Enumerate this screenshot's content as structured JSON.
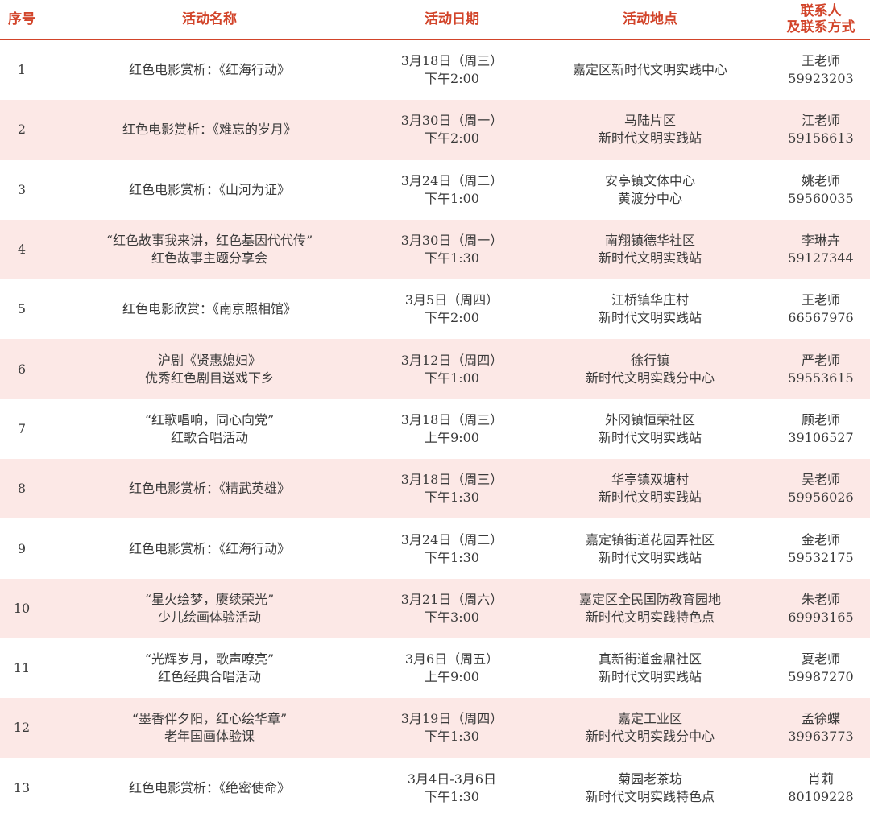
{
  "header": {
    "no": "序号",
    "name": "活动名称",
    "date": "活动日期",
    "place": "活动地点",
    "contact_line1": "联系人",
    "contact_line2": "及联系方式"
  },
  "rows": [
    {
      "no": "1",
      "name": [
        "红色电影赏析：《红海行动》"
      ],
      "date": [
        "3月18日（周三）",
        "下午2:00"
      ],
      "place": [
        "嘉定区新时代文明实践中心"
      ],
      "contact": [
        "王老师",
        "59923203"
      ]
    },
    {
      "no": "2",
      "name": [
        "红色电影赏析：《难忘的岁月》"
      ],
      "date": [
        "3月30日（周一）",
        "下午2:00"
      ],
      "place": [
        "马陆片区",
        "新时代文明实践站"
      ],
      "contact": [
        "江老师",
        "59156613"
      ]
    },
    {
      "no": "3",
      "name": [
        "红色电影赏析：《山河为证》"
      ],
      "date": [
        "3月24日（周二）",
        "下午1:00"
      ],
      "place": [
        "安亭镇文体中心",
        "黄渡分中心"
      ],
      "contact": [
        "姚老师",
        "59560035"
      ]
    },
    {
      "no": "4",
      "name": [
        "“红色故事我来讲，红色基因代代传”",
        "红色故事主题分享会"
      ],
      "date": [
        "3月30日（周一）",
        "下午1:30"
      ],
      "place": [
        "南翔镇德华社区",
        "新时代文明实践站"
      ],
      "contact": [
        "李琳卉",
        "59127344"
      ]
    },
    {
      "no": "5",
      "name": [
        "红色电影欣赏：《南京照相馆》"
      ],
      "date": [
        "3月5日（周四）",
        "下午2:00"
      ],
      "place": [
        "江桥镇华庄村",
        "新时代文明实践站"
      ],
      "contact": [
        "王老师",
        "66567976"
      ]
    },
    {
      "no": "6",
      "name": [
        "沪剧《贤惠媳妇》",
        "优秀红色剧目送戏下乡"
      ],
      "date": [
        "3月12日（周四）",
        "下午1:00"
      ],
      "place": [
        "徐行镇",
        "新时代文明实践分中心"
      ],
      "contact": [
        "严老师",
        "59553615"
      ]
    },
    {
      "no": "7",
      "name": [
        "“红歌唱响，同心向党”",
        "红歌合唱活动"
      ],
      "date": [
        "3月18日（周三）",
        "上午9:00"
      ],
      "place": [
        "外冈镇恒荣社区",
        "新时代文明实践站"
      ],
      "contact": [
        "顾老师",
        "39106527"
      ]
    },
    {
      "no": "8",
      "name": [
        "红色电影赏析：《精武英雄》"
      ],
      "date": [
        "3月18日（周三）",
        "下午1:30"
      ],
      "place": [
        "华亭镇双塘村",
        "新时代文明实践站"
      ],
      "contact": [
        "吴老师",
        "59956026"
      ]
    },
    {
      "no": "9",
      "name": [
        "红色电影赏析：《红海行动》"
      ],
      "date": [
        "3月24日（周二）",
        "下午1:30"
      ],
      "place": [
        "嘉定镇街道花园弄社区",
        "新时代文明实践站"
      ],
      "contact": [
        "金老师",
        "59532175"
      ]
    },
    {
      "no": "10",
      "name": [
        "“星火绘梦，赓续荣光”",
        "少儿绘画体验活动"
      ],
      "date": [
        "3月21日（周六）",
        "下午3:00"
      ],
      "place": [
        "嘉定区全民国防教育园地",
        "新时代文明实践特色点"
      ],
      "contact": [
        "朱老师",
        "69993165"
      ]
    },
    {
      "no": "11",
      "name": [
        "“光辉岁月，歌声嘹亮”",
        "红色经典合唱活动"
      ],
      "date": [
        "3月6日（周五）",
        "上午9:00"
      ],
      "place": [
        "真新街道金鼎社区",
        "新时代文明实践站"
      ],
      "contact": [
        "夏老师",
        "59987270"
      ]
    },
    {
      "no": "12",
      "name": [
        "“墨香伴夕阳，红心绘华章”",
        "老年国画体验课"
      ],
      "date": [
        "3月19日（周四）",
        "下午1:30"
      ],
      "place": [
        "嘉定工业区",
        "新时代文明实践分中心"
      ],
      "contact": [
        "孟徐蝶",
        "39963773"
      ]
    },
    {
      "no": "13",
      "name": [
        "红色电影赏析：《绝密使命》"
      ],
      "date": [
        "3月4日-3月6日",
        "下午1:30"
      ],
      "place": [
        "菊园老茶坊",
        "新时代文明实践特色点"
      ],
      "contact": [
        "肖莉",
        "80109228"
      ]
    }
  ],
  "colors": {
    "header_text": "#d2442a",
    "shade_row": "#fce8e6",
    "body_text": "#3a3a3a"
  }
}
